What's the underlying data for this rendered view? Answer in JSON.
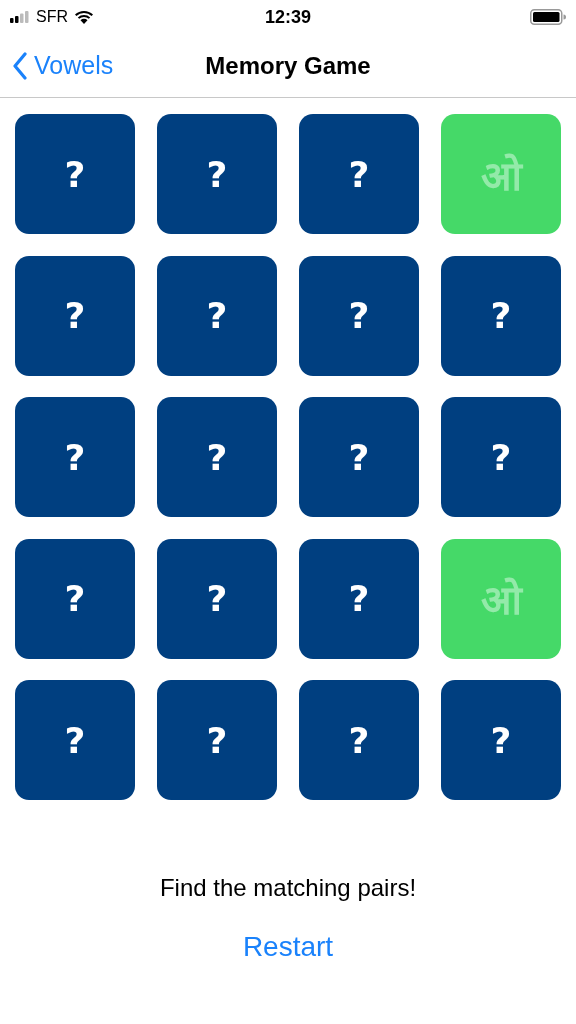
{
  "status_bar": {
    "carrier": "SFR",
    "time": "12:39"
  },
  "nav": {
    "back": "Vowels",
    "title": "Memory Game"
  },
  "cards": [
    {
      "kind": "hidden",
      "text": "?"
    },
    {
      "kind": "hidden",
      "text": "?"
    },
    {
      "kind": "hidden",
      "text": "?"
    },
    {
      "kind": "matched",
      "text": "ओ"
    },
    {
      "kind": "hidden",
      "text": "?"
    },
    {
      "kind": "hidden",
      "text": "?"
    },
    {
      "kind": "hidden",
      "text": "?"
    },
    {
      "kind": "hidden",
      "text": "?"
    },
    {
      "kind": "hidden",
      "text": "?"
    },
    {
      "kind": "hidden",
      "text": "?"
    },
    {
      "kind": "hidden",
      "text": "?"
    },
    {
      "kind": "hidden",
      "text": "?"
    },
    {
      "kind": "hidden",
      "text": "?"
    },
    {
      "kind": "hidden",
      "text": "?"
    },
    {
      "kind": "hidden",
      "text": "?"
    },
    {
      "kind": "matched",
      "text": "ओ"
    },
    {
      "kind": "hidden",
      "text": "?"
    },
    {
      "kind": "hidden",
      "text": "?"
    },
    {
      "kind": "hidden",
      "text": "?"
    },
    {
      "kind": "hidden",
      "text": "?"
    }
  ],
  "message": "Find the matching pairs!",
  "restart": "Restart"
}
